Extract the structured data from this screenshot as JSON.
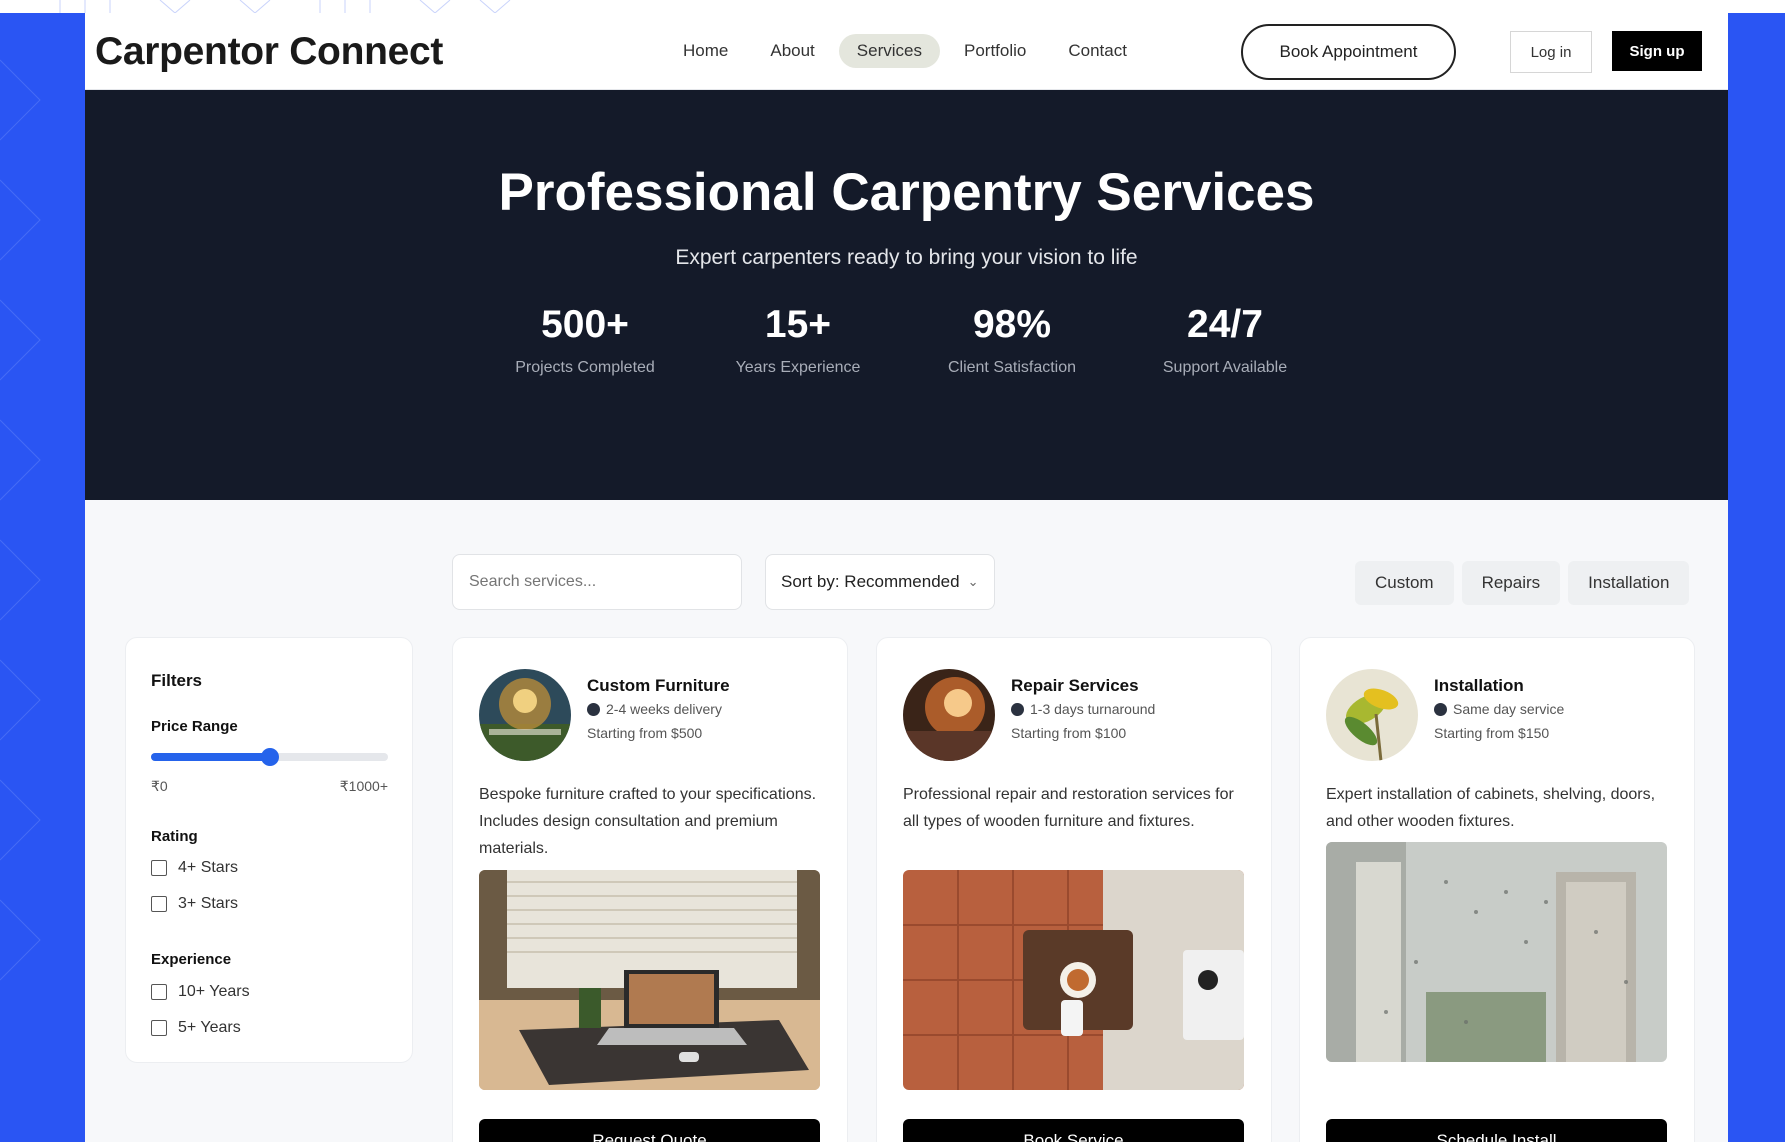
{
  "brand": "Carpentor Connect",
  "nav": {
    "links": [
      "Home",
      "About",
      "Services",
      "Portfolio",
      "Contact"
    ],
    "active": "Services",
    "book_label": "Book Appointment",
    "login_label": "Log in",
    "signup_label": "Sign up"
  },
  "hero": {
    "title": "Professional Carpentry Services",
    "subtitle": "Expert carpenters ready to bring your vision to life",
    "stats": [
      {
        "value": "500+",
        "label": "Projects Completed"
      },
      {
        "value": "15+",
        "label": "Years Experience"
      },
      {
        "value": "98%",
        "label": "Client Satisfaction"
      },
      {
        "value": "24/7",
        "label": "Support Available"
      }
    ]
  },
  "toolbar": {
    "search_placeholder": "Search services...",
    "sort_label": "Sort by: Recommended",
    "chips": [
      "Custom",
      "Repairs",
      "Installation"
    ]
  },
  "filters": {
    "title": "Filters",
    "price_label": "Price Range",
    "price_min": "₹0",
    "price_max": "₹1000+",
    "price_value_fraction": 0.5,
    "rating_label": "Rating",
    "rating_options": [
      "4+ Stars",
      "3+ Stars"
    ],
    "experience_label": "Experience",
    "experience_options": [
      "10+ Years",
      "5+ Years"
    ]
  },
  "cards": [
    {
      "title": "Custom Furniture",
      "meta": "2-4 weeks delivery",
      "price": "Starting from $500",
      "description": "Bespoke furniture crafted to your specifications. Includes design consultation and premium materials.",
      "button": "Request Quote"
    },
    {
      "title": "Repair Services",
      "meta": "1-3 days turnaround",
      "price": "Starting from $100",
      "description": "Professional repair and restoration services for all types of wooden furniture and fixtures.",
      "button": "Book Service"
    },
    {
      "title": "Installation",
      "meta": "Same day service",
      "price": "Starting from $150",
      "description": "Expert installation of cabinets, shelving, doors, and other wooden fixtures.",
      "button": "Schedule Install"
    }
  ],
  "colors": {
    "accent": "#2563eb",
    "hero_bg": "#141a29",
    "frame_bg": "#2a55f3"
  }
}
